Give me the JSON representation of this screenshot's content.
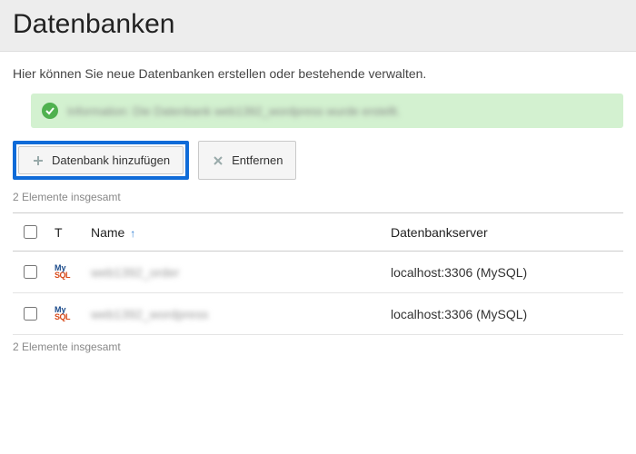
{
  "header": {
    "title": "Datenbanken"
  },
  "intro": "Hier können Sie neue Datenbanken erstellen oder bestehende verwalten.",
  "alert": {
    "icon": "check-circle",
    "text": "Information: Die Datenbank web1392_wordpress wurde erstellt."
  },
  "toolbar": {
    "add_label": "Datenbank hinzufügen",
    "remove_label": "Entfernen"
  },
  "count_text": "2 Elemente insgesamt",
  "columns": {
    "type": "T",
    "name": "Name",
    "server": "Datenbankserver"
  },
  "sort_indicator": "↑",
  "rows": [
    {
      "type_icon": "mysql",
      "name": "web1392_order",
      "server": "localhost:3306 (MySQL)"
    },
    {
      "type_icon": "mysql",
      "name": "web1392_wordpress",
      "server": "localhost:3306 (MySQL)"
    }
  ]
}
